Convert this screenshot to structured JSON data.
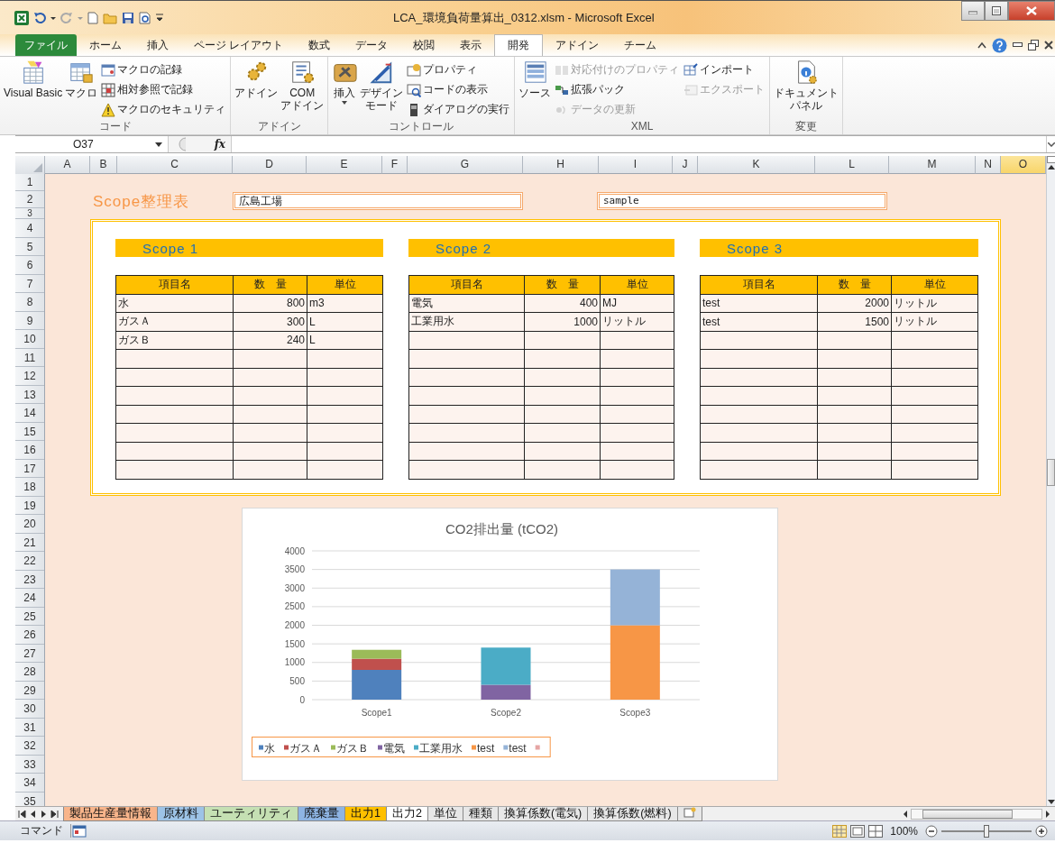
{
  "window": {
    "title": "LCA_環境負荷量算出_0312.xlsm - Microsoft Excel"
  },
  "ribbon_tabs": [
    {
      "label": "ファイル",
      "kind": "file",
      "selected": false
    },
    {
      "label": "ホーム",
      "kind": "tab",
      "selected": false
    },
    {
      "label": "挿入",
      "kind": "tab",
      "selected": false
    },
    {
      "label": "ページ レイアウト",
      "kind": "tab",
      "selected": false
    },
    {
      "label": "数式",
      "kind": "tab",
      "selected": false
    },
    {
      "label": "データ",
      "kind": "tab",
      "selected": false
    },
    {
      "label": "校閲",
      "kind": "tab",
      "selected": false
    },
    {
      "label": "表示",
      "kind": "tab",
      "selected": false
    },
    {
      "label": "開発",
      "kind": "tab",
      "selected": true
    },
    {
      "label": "アドイン",
      "kind": "tab",
      "selected": false
    },
    {
      "label": "チーム",
      "kind": "tab",
      "selected": false
    }
  ],
  "ribbon_groups": [
    {
      "label": "コード",
      "items": [
        {
          "label": "Visual Basic",
          "kind": "large",
          "disabled": false
        },
        {
          "label": "マクロ",
          "kind": "large",
          "disabled": false
        },
        {
          "label": "マクロの記録",
          "kind": "small",
          "disabled": false
        },
        {
          "label": "相対参照で記録",
          "kind": "small",
          "disabled": false
        },
        {
          "label": "マクロのセキュリティ",
          "kind": "small",
          "disabled": false
        }
      ]
    },
    {
      "label": "アドイン",
      "items": [
        {
          "label": "アドイン",
          "kind": "large",
          "disabled": false
        },
        {
          "lines": [
            "COM",
            "アドイン"
          ],
          "kind": "large",
          "disabled": false
        }
      ]
    },
    {
      "label": "コントロール",
      "items": [
        {
          "label": "挿入",
          "kind": "large",
          "disabled": false,
          "dropdown": true
        },
        {
          "lines": [
            "デザイン",
            "モード"
          ],
          "kind": "large",
          "disabled": false
        },
        {
          "label": "プロパティ",
          "kind": "small",
          "disabled": false
        },
        {
          "label": "コードの表示",
          "kind": "small",
          "disabled": false
        },
        {
          "label": "ダイアログの実行",
          "kind": "small",
          "disabled": false
        }
      ]
    },
    {
      "label": "XML",
      "items": [
        {
          "label": "ソース",
          "kind": "large",
          "disabled": false
        },
        {
          "label": "対応付けのプロパティ",
          "kind": "small",
          "disabled": true
        },
        {
          "label": "拡張パック",
          "kind": "small",
          "disabled": false
        },
        {
          "label": "データの更新",
          "kind": "small",
          "disabled": true
        },
        {
          "label": "インポート",
          "kind": "small",
          "disabled": false
        },
        {
          "label": "エクスポート",
          "kind": "small",
          "disabled": true
        }
      ]
    },
    {
      "label": "変更",
      "items": [
        {
          "lines": [
            "ドキュメント",
            "パネル"
          ],
          "kind": "large",
          "disabled": false
        }
      ]
    }
  ],
  "formula_bar": {
    "name_box": "O37",
    "function_label": "fx"
  },
  "columns": [
    {
      "label": "A",
      "selected": false
    },
    {
      "label": "B",
      "selected": false
    },
    {
      "label": "C",
      "selected": false
    },
    {
      "label": "D",
      "selected": false
    },
    {
      "label": "E",
      "selected": false
    },
    {
      "label": "F",
      "selected": false
    },
    {
      "label": "G",
      "selected": false
    },
    {
      "label": "H",
      "selected": false
    },
    {
      "label": "I",
      "selected": false
    },
    {
      "label": "J",
      "selected": false
    },
    {
      "label": "K",
      "selected": false
    },
    {
      "label": "L",
      "selected": false
    },
    {
      "label": "M",
      "selected": false
    },
    {
      "label": "N",
      "selected": false
    },
    {
      "label": "O",
      "selected": true
    }
  ],
  "rows": [
    "1",
    "2",
    "3",
    "4",
    "5",
    "6",
    "7",
    "8",
    "9",
    "10",
    "11",
    "12",
    "13",
    "14",
    "15",
    "16",
    "17",
    "18",
    "19",
    "20",
    "21",
    "22",
    "23",
    "24",
    "25",
    "26",
    "27",
    "28",
    "29",
    "30",
    "31",
    "32",
    "33",
    "34",
    "35"
  ],
  "sheet": {
    "title": "Scope整理表",
    "fields": [
      {
        "value": "広島工場"
      },
      {
        "value": "sample"
      }
    ],
    "scopes": [
      {
        "heading": "Scope 1",
        "columns": [
          "項目名",
          "数　量",
          "単位"
        ],
        "rows": [
          [
            "水",
            "800",
            "m3"
          ],
          [
            "ガスＡ",
            "300",
            "L"
          ],
          [
            "ガスＢ",
            "240",
            "L"
          ]
        ]
      },
      {
        "heading": "Scope 2",
        "columns": [
          "項目名",
          "数　量",
          "単位"
        ],
        "rows": [
          [
            "電気",
            "400",
            "MJ"
          ],
          [
            "工業用水",
            "1000",
            "リットル"
          ]
        ]
      },
      {
        "heading": "Scope 3",
        "columns": [
          "項目名",
          "数　量",
          "単位"
        ],
        "rows": [
          [
            "test",
            "2000",
            "リットル"
          ],
          [
            "test",
            "1500",
            "リットル"
          ]
        ]
      }
    ],
    "chart": {
      "chart_data": {
        "type": "bar",
        "title": "CO2排出量 (tCO2)",
        "stacked": true,
        "grid": true,
        "legend": "bottom",
        "orientation": "vertical",
        "categories": [
          "Scope1",
          "Scope2",
          "Scope3"
        ],
        "ylim": [
          0,
          4000
        ],
        "yticks": [
          0,
          500,
          1000,
          1500,
          2000,
          2500,
          3000,
          3500,
          4000
        ],
        "series": [
          {
            "name": "水",
            "color": "#4f81bd",
            "values": [
              800,
              null,
              null
            ]
          },
          {
            "name": "ガスＡ",
            "color": "#c0504d",
            "values": [
              300,
              null,
              null
            ]
          },
          {
            "name": "ガスＢ",
            "color": "#9bbb59",
            "values": [
              240,
              null,
              null
            ]
          },
          {
            "name": "電気",
            "color": "#8064a2",
            "values": [
              null,
              400,
              null
            ]
          },
          {
            "name": "工業用水",
            "color": "#4bacc6",
            "values": [
              null,
              1000,
              null
            ]
          },
          {
            "name": "test",
            "color": "#f79646",
            "values": [
              null,
              null,
              2000
            ]
          },
          {
            "name": "test",
            "color": "#95b3d7",
            "values": [
              null,
              null,
              1500
            ]
          },
          {
            "color": "#e6a5a4",
            "values": [
              null,
              null,
              null
            ]
          }
        ]
      }
    }
  },
  "sheet_tabs": [
    {
      "label": "製品生産量情報",
      "selected": false,
      "color": "#f8b58b"
    },
    {
      "label": "原材料",
      "selected": false,
      "color": "#9dc3e6"
    },
    {
      "label": "ユーティリティ",
      "selected": false,
      "color": "#c5e0b3"
    },
    {
      "label": "廃棄量",
      "selected": false,
      "color": "#8eb4e3"
    },
    {
      "label": "出力1",
      "selected": false,
      "color": "#ffc000"
    },
    {
      "label": "出力2",
      "selected": true
    },
    {
      "label": "単位",
      "selected": false
    },
    {
      "label": "種類",
      "selected": false
    },
    {
      "label": "換算係数(電気)",
      "selected": false
    },
    {
      "label": "換算係数(燃料)",
      "selected": false
    }
  ],
  "status_bar": {
    "mode": "コマンド",
    "zoom": "100%",
    "zoom_slider": {
      "level": 0.5
    }
  }
}
